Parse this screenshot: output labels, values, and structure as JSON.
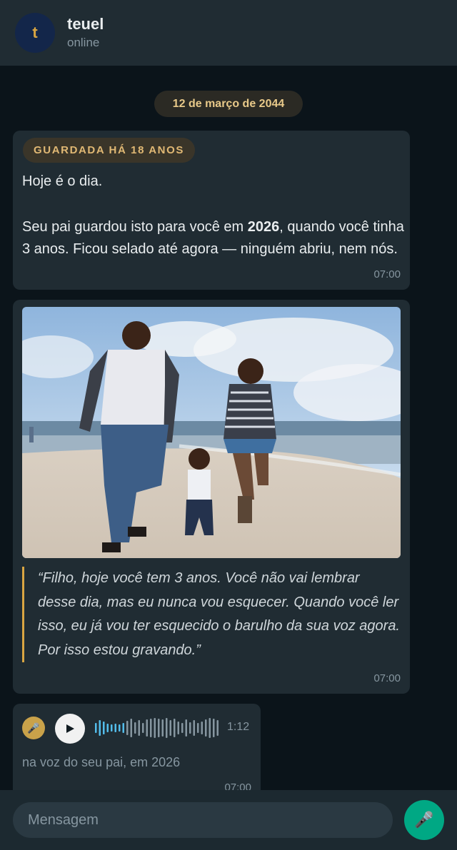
{
  "header": {
    "avatar_letter": "t",
    "name": "teuel",
    "status": "online"
  },
  "date_divider": "12 de março de 2044",
  "messages": [
    {
      "badge": "GUARDADA HÁ 18 ANOS",
      "paragraph1": "Hoje é o dia.",
      "p2_before": "Seu pai guardou isto para você em ",
      "p2_bold": "2026",
      "p2_after": ", quando você tinha 3 anos. Ficou selado até agora — ninguém abriu, nem nós.",
      "time": "07:00"
    },
    {
      "photo_icon": "family-beach-photo",
      "quote": "“Filho, hoje você tem 3 anos. Você não vai lembrar desse dia, mas eu nunca vou esquecer. Quando você ler isso, eu já vou ter esquecido o barulho da sua voz agora. Por isso estou gravando.”",
      "time": "07:00"
    },
    {
      "mic_icon": "microphone-icon",
      "play_icon": "play-icon",
      "duration": "1:12",
      "caption": "na voz do seu pai, em 2026",
      "time": "07:00",
      "played_fraction": 0.25
    }
  ],
  "composer": {
    "placeholder": "Mensagem",
    "mic_icon": "microphone-icon"
  },
  "colors": {
    "accent": "#00a884",
    "gold": "#d9a542",
    "bubble": "#202c33",
    "background": "#0b141a"
  }
}
